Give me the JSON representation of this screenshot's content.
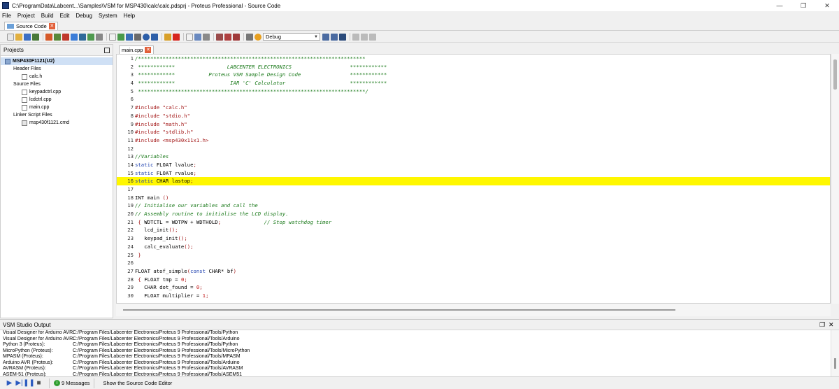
{
  "window": {
    "title": "C:\\ProgramData\\Labcent...\\Samples\\VSM for MSP430\\calc\\calc.pdsprj - Proteus Professional - Source Code",
    "minimize": "—",
    "restore": "❐",
    "close": "✕"
  },
  "menu": [
    "File",
    "Project",
    "Build",
    "Edit",
    "Debug",
    "System",
    "Help"
  ],
  "top_tab": {
    "label": "Source Code",
    "close": "✕"
  },
  "toolbar": {
    "config_value": "Debug"
  },
  "projects": {
    "title": "Projects",
    "tree": [
      {
        "label": "MSP430F1121(U2)",
        "level": 0,
        "type": "chip"
      },
      {
        "label": "Header Files",
        "level": 1,
        "type": "folder"
      },
      {
        "label": "calc.h",
        "level": 2,
        "type": "file"
      },
      {
        "label": "Source Files",
        "level": 1,
        "type": "folder"
      },
      {
        "label": "keypadctrl.cpp",
        "level": 2,
        "type": "file"
      },
      {
        "label": "lcdctrl.cpp",
        "level": 2,
        "type": "file"
      },
      {
        "label": "main.cpp",
        "level": 2,
        "type": "file"
      },
      {
        "label": "Linker Script Files",
        "level": 1,
        "type": "folder"
      },
      {
        "label": "msp430f1121.cmd",
        "level": 2,
        "type": "cmd"
      }
    ]
  },
  "editor": {
    "tab_label": "main.cpp",
    "tab_close": "✕",
    "highlight_line": 16,
    "lines": [
      {
        "n": "1",
        "t": "/**************************************************************************",
        "c": "comment"
      },
      {
        "n": "2",
        "t": " ************                 LABCENTER ELECTRONICS                   ************",
        "c": "comment"
      },
      {
        "n": "3",
        "t": " ************           Proteus VSM Sample Design Code                ************",
        "c": "comment"
      },
      {
        "n": "4",
        "t": " ************                  IAR 'C' Calculator                     ************",
        "c": "comment"
      },
      {
        "n": "5",
        "t": " **************************************************************************/",
        "c": "comment"
      },
      {
        "n": "6",
        "t": "",
        "c": "plain"
      },
      {
        "n": "7",
        "t": "#include \"calc.h\"",
        "c": "pre"
      },
      {
        "n": "8",
        "t": "#include \"stdio.h\"",
        "c": "pre"
      },
      {
        "n": "9",
        "t": "#include \"math.h\"",
        "c": "pre"
      },
      {
        "n": "10",
        "t": "#include \"stdlib.h\"",
        "c": "pre"
      },
      {
        "n": "11",
        "t": "#include <msp430x11x1.h>",
        "c": "pre"
      },
      {
        "n": "12",
        "t": "",
        "c": "plain"
      },
      {
        "n": "13",
        "t": "//Variables",
        "c": "comment"
      },
      {
        "n": "14",
        "t": "static FLOAT lvalue;",
        "c": "kw"
      },
      {
        "n": "15",
        "t": "static FLOAT rvalue;",
        "c": "kw"
      },
      {
        "n": "16",
        "t": "static CHAR lastop;",
        "c": "kw"
      },
      {
        "n": "17",
        "t": "",
        "c": "plain"
      },
      {
        "n": "18",
        "t": "INT main ()",
        "c": "plain"
      },
      {
        "n": "19",
        "t": "// Initialise our variables and call the",
        "c": "comment"
      },
      {
        "n": "20",
        "t": "// Assembly routine to initialise the LCD display.",
        "c": "comment"
      },
      {
        "n": "21",
        "t": " { WDTCTL = WDTPW + WDTHOLD;              // Stop watchdog timer",
        "c": "mixed21"
      },
      {
        "n": "22",
        "t": "   lcd_init();",
        "c": "plain"
      },
      {
        "n": "23",
        "t": "   keypad_init();",
        "c": "plain"
      },
      {
        "n": "24",
        "t": "   calc_evaluate();",
        "c": "plain"
      },
      {
        "n": "25",
        "t": " }",
        "c": "pre"
      },
      {
        "n": "26",
        "t": "",
        "c": "plain"
      },
      {
        "n": "27",
        "t": "FLOAT atof_simple(const CHAR* bf)",
        "c": "plain"
      },
      {
        "n": "28",
        "t": " { FLOAT tmp = 0;",
        "c": "num"
      },
      {
        "n": "29",
        "t": "   CHAR dot_found = 0;",
        "c": "num"
      },
      {
        "n": "30",
        "t": "   FLOAT multiplier = 1;",
        "c": "num"
      }
    ]
  },
  "output": {
    "title": "VSM Studio Output",
    "restore": "❐",
    "close": "✕",
    "lines": [
      {
        "tool": "Visual Designer for Arduino AVR:",
        "path": "C:/Program Files/Labcenter Electronics/Proteus 9 Professional/Tools/Python"
      },
      {
        "tool": "Visual Designer for Arduino AVR:",
        "path": "C:/Program Files/Labcenter Electronics/Proteus 9 Professional/Tools/Arduino"
      },
      {
        "tool": "Python 3 (Proteus):",
        "path": "C:/Program Files/Labcenter Electronics/Proteus 9 Professional/Tools/Python"
      },
      {
        "tool": "MicroPython (Proteus):",
        "path": "C:/Program Files/Labcenter Electronics/Proteus 9 Professional/Tools/MicroPython"
      },
      {
        "tool": "MPASM (Proteus):",
        "path": "C:/Program Files/Labcenter Electronics/Proteus 9 Professional/Tools/MPASM"
      },
      {
        "tool": "Arduino AVR (Proteus):",
        "path": "C:/Program Files/Labcenter Electronics/Proteus 9 Professional/Tools/Arduino"
      },
      {
        "tool": "AVRASM (Proteus):",
        "path": "C:/Program Files/Labcenter Electronics/Proteus 9 Professional/Tools/AVRASM"
      },
      {
        "tool": "ASEM-51 (Proteus):",
        "path": "C:/Program Files/Labcenter Electronics/Proteus 9 Professional/Tools/ASEM51"
      }
    ]
  },
  "status": {
    "messages": "9 Messages",
    "info_glyph": "i",
    "text": "Show the Source Code Editor",
    "play": "▶",
    "step": "▶|",
    "pause": "❚❚",
    "stop": "■"
  }
}
